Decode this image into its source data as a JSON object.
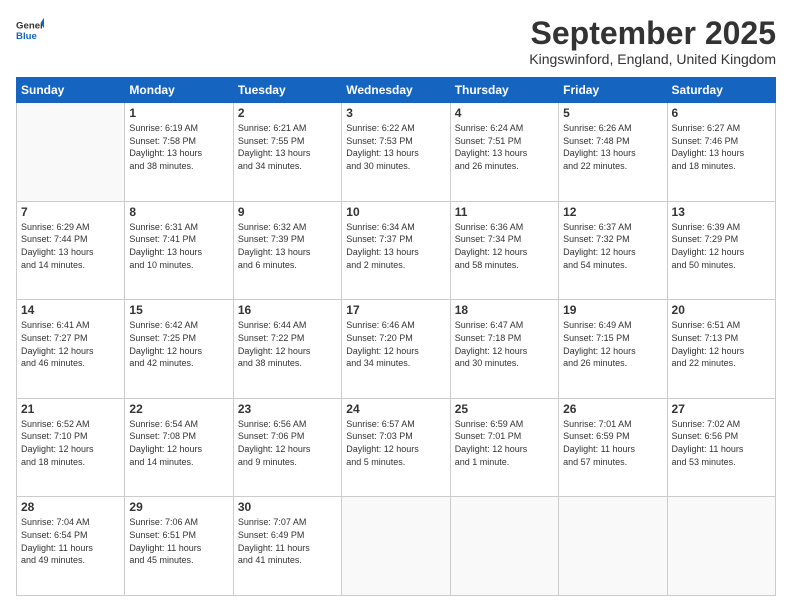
{
  "logo": {
    "general": "General",
    "blue": "Blue"
  },
  "header": {
    "month_title": "September 2025",
    "location": "Kingswinford, England, United Kingdom"
  },
  "days_of_week": [
    "Sunday",
    "Monday",
    "Tuesday",
    "Wednesday",
    "Thursday",
    "Friday",
    "Saturday"
  ],
  "weeks": [
    [
      {
        "day": "",
        "content": ""
      },
      {
        "day": "1",
        "content": "Sunrise: 6:19 AM\nSunset: 7:58 PM\nDaylight: 13 hours\nand 38 minutes."
      },
      {
        "day": "2",
        "content": "Sunrise: 6:21 AM\nSunset: 7:55 PM\nDaylight: 13 hours\nand 34 minutes."
      },
      {
        "day": "3",
        "content": "Sunrise: 6:22 AM\nSunset: 7:53 PM\nDaylight: 13 hours\nand 30 minutes."
      },
      {
        "day": "4",
        "content": "Sunrise: 6:24 AM\nSunset: 7:51 PM\nDaylight: 13 hours\nand 26 minutes."
      },
      {
        "day": "5",
        "content": "Sunrise: 6:26 AM\nSunset: 7:48 PM\nDaylight: 13 hours\nand 22 minutes."
      },
      {
        "day": "6",
        "content": "Sunrise: 6:27 AM\nSunset: 7:46 PM\nDaylight: 13 hours\nand 18 minutes."
      }
    ],
    [
      {
        "day": "7",
        "content": "Sunrise: 6:29 AM\nSunset: 7:44 PM\nDaylight: 13 hours\nand 14 minutes."
      },
      {
        "day": "8",
        "content": "Sunrise: 6:31 AM\nSunset: 7:41 PM\nDaylight: 13 hours\nand 10 minutes."
      },
      {
        "day": "9",
        "content": "Sunrise: 6:32 AM\nSunset: 7:39 PM\nDaylight: 13 hours\nand 6 minutes."
      },
      {
        "day": "10",
        "content": "Sunrise: 6:34 AM\nSunset: 7:37 PM\nDaylight: 13 hours\nand 2 minutes."
      },
      {
        "day": "11",
        "content": "Sunrise: 6:36 AM\nSunset: 7:34 PM\nDaylight: 12 hours\nand 58 minutes."
      },
      {
        "day": "12",
        "content": "Sunrise: 6:37 AM\nSunset: 7:32 PM\nDaylight: 12 hours\nand 54 minutes."
      },
      {
        "day": "13",
        "content": "Sunrise: 6:39 AM\nSunset: 7:29 PM\nDaylight: 12 hours\nand 50 minutes."
      }
    ],
    [
      {
        "day": "14",
        "content": "Sunrise: 6:41 AM\nSunset: 7:27 PM\nDaylight: 12 hours\nand 46 minutes."
      },
      {
        "day": "15",
        "content": "Sunrise: 6:42 AM\nSunset: 7:25 PM\nDaylight: 12 hours\nand 42 minutes."
      },
      {
        "day": "16",
        "content": "Sunrise: 6:44 AM\nSunset: 7:22 PM\nDaylight: 12 hours\nand 38 minutes."
      },
      {
        "day": "17",
        "content": "Sunrise: 6:46 AM\nSunset: 7:20 PM\nDaylight: 12 hours\nand 34 minutes."
      },
      {
        "day": "18",
        "content": "Sunrise: 6:47 AM\nSunset: 7:18 PM\nDaylight: 12 hours\nand 30 minutes."
      },
      {
        "day": "19",
        "content": "Sunrise: 6:49 AM\nSunset: 7:15 PM\nDaylight: 12 hours\nand 26 minutes."
      },
      {
        "day": "20",
        "content": "Sunrise: 6:51 AM\nSunset: 7:13 PM\nDaylight: 12 hours\nand 22 minutes."
      }
    ],
    [
      {
        "day": "21",
        "content": "Sunrise: 6:52 AM\nSunset: 7:10 PM\nDaylight: 12 hours\nand 18 minutes."
      },
      {
        "day": "22",
        "content": "Sunrise: 6:54 AM\nSunset: 7:08 PM\nDaylight: 12 hours\nand 14 minutes."
      },
      {
        "day": "23",
        "content": "Sunrise: 6:56 AM\nSunset: 7:06 PM\nDaylight: 12 hours\nand 9 minutes."
      },
      {
        "day": "24",
        "content": "Sunrise: 6:57 AM\nSunset: 7:03 PM\nDaylight: 12 hours\nand 5 minutes."
      },
      {
        "day": "25",
        "content": "Sunrise: 6:59 AM\nSunset: 7:01 PM\nDaylight: 12 hours\nand 1 minute."
      },
      {
        "day": "26",
        "content": "Sunrise: 7:01 AM\nSunset: 6:59 PM\nDaylight: 11 hours\nand 57 minutes."
      },
      {
        "day": "27",
        "content": "Sunrise: 7:02 AM\nSunset: 6:56 PM\nDaylight: 11 hours\nand 53 minutes."
      }
    ],
    [
      {
        "day": "28",
        "content": "Sunrise: 7:04 AM\nSunset: 6:54 PM\nDaylight: 11 hours\nand 49 minutes."
      },
      {
        "day": "29",
        "content": "Sunrise: 7:06 AM\nSunset: 6:51 PM\nDaylight: 11 hours\nand 45 minutes."
      },
      {
        "day": "30",
        "content": "Sunrise: 7:07 AM\nSunset: 6:49 PM\nDaylight: 11 hours\nand 41 minutes."
      },
      {
        "day": "",
        "content": ""
      },
      {
        "day": "",
        "content": ""
      },
      {
        "day": "",
        "content": ""
      },
      {
        "day": "",
        "content": ""
      }
    ]
  ]
}
